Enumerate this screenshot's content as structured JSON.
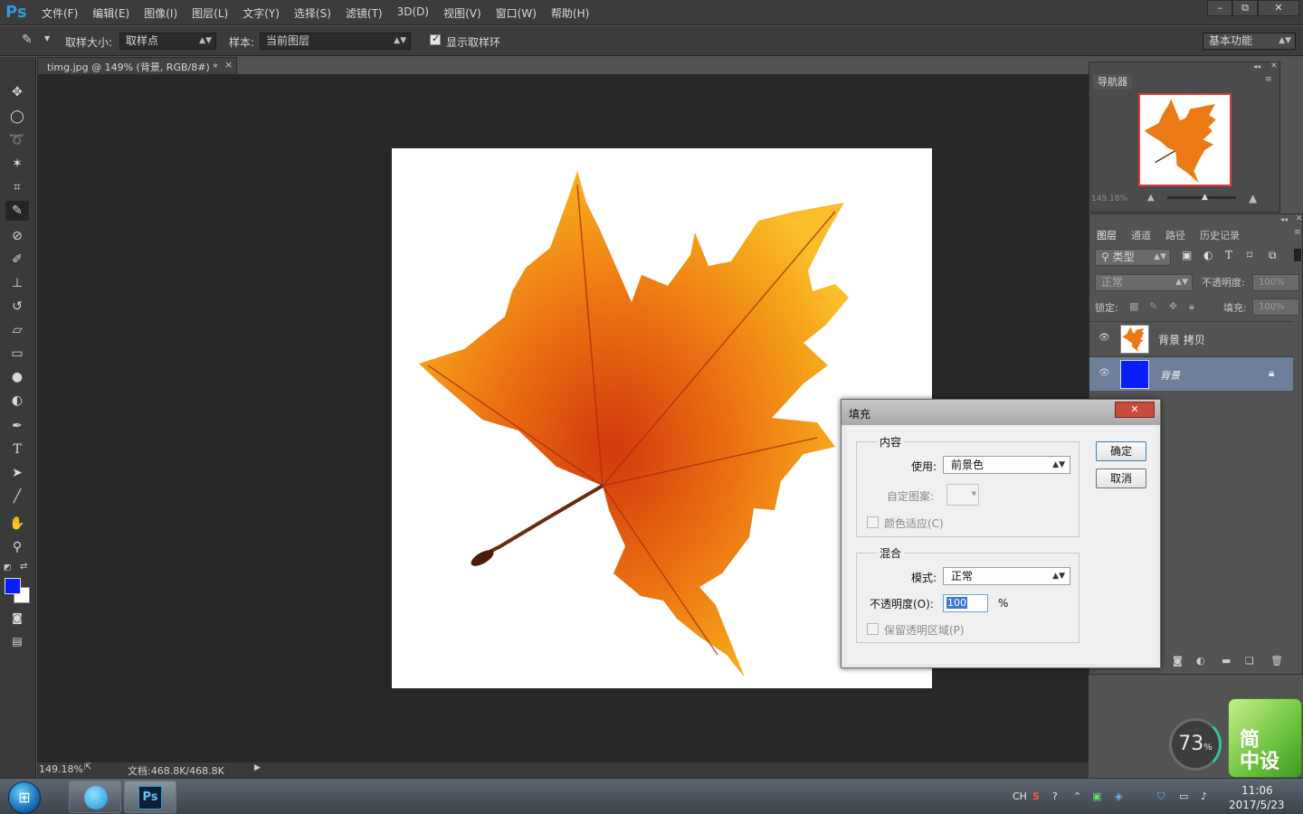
{
  "app": {
    "logo": "Ps",
    "menus": [
      "文件(F)",
      "编辑(E)",
      "图像(I)",
      "图层(L)",
      "文字(Y)",
      "选择(S)",
      "滤镜(T)",
      "3D(D)",
      "视图(V)",
      "窗口(W)",
      "帮助(H)"
    ]
  },
  "window_controls": {
    "minimize": "–",
    "restore": "⧉",
    "close": "✕"
  },
  "options": {
    "sample_size_label": "取样大小:",
    "sample_size_value": "取样点",
    "sample_label": "样本:",
    "sample_value": "当前图层",
    "show_ring_label": "显示取样环",
    "show_ring_checked": true,
    "workspace": "基本功能"
  },
  "document": {
    "tab_title": "timg.jpg @ 149% (背景, RGB/8#) *",
    "tab_close": "×",
    "zoom": "149.18%",
    "doc_size": "文档:468.8K/468.8K"
  },
  "navigator": {
    "tab": "导航器",
    "zoom": "149.18%"
  },
  "layers": {
    "tabs": [
      "图层",
      "通道",
      "路径",
      "历史记录"
    ],
    "filter_label": "类型",
    "blend_mode": "正常",
    "opacity_label": "不透明度:",
    "opacity_value": "100%",
    "lock_label": "锁定:",
    "fill_label": "填充:",
    "fill_value": "100%",
    "items": [
      {
        "name": "背景 拷贝",
        "selected": false
      },
      {
        "name": "背景",
        "selected": true,
        "locked": true,
        "color": "#0a1dff"
      }
    ]
  },
  "fill_dialog": {
    "title": "填充",
    "close": "✕",
    "content_group": "内容",
    "use_label": "使用:",
    "use_value": "前景色",
    "custom_pattern_label": "自定图案:",
    "color_adapt_label": "颜色适应(C)",
    "blend_group": "混合",
    "mode_label": "模式:",
    "mode_value": "正常",
    "opacity_label": "不透明度(O):",
    "opacity_value": "100",
    "opacity_unit": "%",
    "preserve_label": "保留透明区域(P)",
    "ok": "确定",
    "cancel": "取消"
  },
  "taskbar": {
    "time": "11:06",
    "date": "2017/5/23",
    "lang": "CH"
  },
  "widgets": {
    "speed_value": "73",
    "speed_unit": "%",
    "brand_text": "简\n中设"
  },
  "colors": {
    "foreground": "#0a1dff",
    "background": "#ffffff",
    "accent": "#2d9bd9"
  }
}
